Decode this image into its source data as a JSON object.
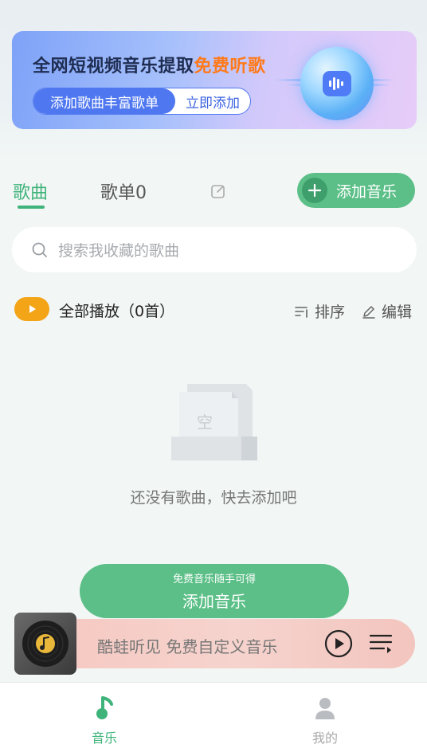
{
  "banner": {
    "title_main": "全网短视频音乐提取",
    "title_highlight": "免费听歌",
    "pill_left": "添加歌曲丰富歌单",
    "pill_right": "立即添加"
  },
  "tabs": {
    "songs": "歌曲",
    "playlists": "歌单0"
  },
  "add_music_button": "添加音乐",
  "search": {
    "placeholder": "搜索我收藏的歌曲"
  },
  "list_header": {
    "play_all": "全部播放（0首）",
    "sort": "排序",
    "edit": "编辑"
  },
  "empty": {
    "illustration_text": "空",
    "message": "还没有歌曲，快去添加吧"
  },
  "big_add": {
    "subtitle": "免费音乐随手可得",
    "label": "添加音乐"
  },
  "player": {
    "text": "酷蛙听见 免费自定义音乐"
  },
  "bottom_nav": {
    "music": "音乐",
    "mine": "我的"
  },
  "colors": {
    "accent_green": "#3fb37a",
    "button_green": "#5bbf87",
    "play_orange": "#f3a417",
    "banner_blue": "#4f78f0",
    "highlight_orange": "#ff7a1a"
  }
}
